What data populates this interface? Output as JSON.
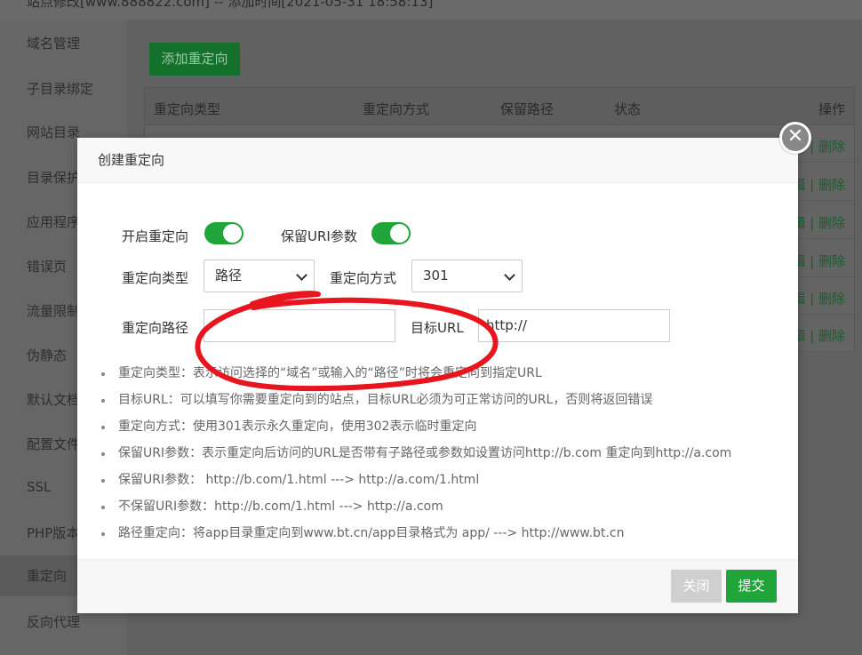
{
  "topbar": {
    "text": "站点修改[www.888822.com] -- 添加时间[2021-05-31 18:58:13]"
  },
  "sidebar": {
    "items": [
      {
        "label": "域名管理"
      },
      {
        "label": "子目录绑定"
      },
      {
        "label": "网站目录"
      },
      {
        "label": "目录保护"
      },
      {
        "label": "应用程序"
      },
      {
        "label": "错误页"
      },
      {
        "label": "流量限制"
      },
      {
        "label": "伪静态"
      },
      {
        "label": "默认文档"
      },
      {
        "label": "配置文件"
      },
      {
        "label": "SSL"
      },
      {
        "label": "PHP版本"
      },
      {
        "label": "重定向"
      },
      {
        "label": "反向代理"
      }
    ]
  },
  "main": {
    "add_button": "添加重定向",
    "table": {
      "headers": [
        "重定向类型",
        "重定向方式",
        "保留路径",
        "状态",
        "操作"
      ],
      "row_action": "编辑 | 删除"
    }
  },
  "modal": {
    "title": "创建重定向",
    "close_symbol": "✕",
    "enable_label": "开启重定向",
    "enable_on": true,
    "keep_uri_label": "保留URI参数",
    "keep_uri_on": true,
    "type_label": "重定向类型",
    "type_value": "路径",
    "method_label": "重定向方式",
    "method_value": "301",
    "path_label": "重定向路径",
    "path_value": "",
    "target_label": "目标URL",
    "target_value": "http://",
    "help": [
      "重定向类型：表示访问选择的“域名”或输入的“路径”时将会重定向到指定URL",
      "目标URL：可以填写你需要重定向到的站点，目标URL必须为可正常访问的URL，否则将返回错误",
      "重定向方式：使用301表示永久重定向，使用302表示临时重定向",
      "保留URI参数：表示重定向后访问的URL是否带有子路径或参数如设置访问http://b.com 重定向到http://a.com",
      "保留URI参数： http://b.com/1.html ---> http://a.com/1.html",
      "不保留URI参数：http://b.com/1.html ---> http://a.com",
      "路径重定向：将app目录重定向到www.bt.cn/app目录格式为 app/ ---> http://www.bt.cn"
    ],
    "close_button": "关闭",
    "submit_button": "提交"
  },
  "colors": {
    "accent": "#20a53a",
    "overlay": "#5f5f5f",
    "annotation": "#e8141e"
  },
  "icons": [
    "close-icon",
    "chevron-down-icon"
  ]
}
